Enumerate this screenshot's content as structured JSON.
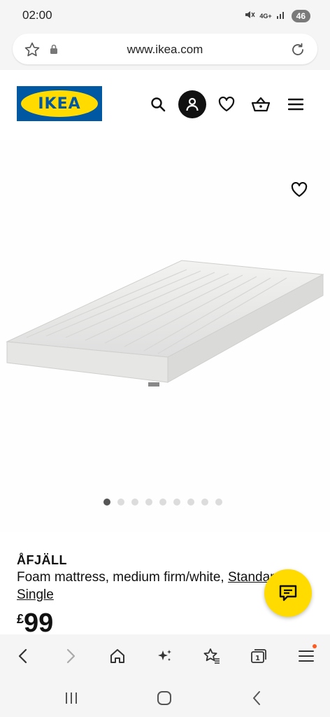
{
  "status_bar": {
    "time": "02:00",
    "network": "4G+",
    "battery": "46"
  },
  "browser": {
    "url": "www.ikea.com"
  },
  "header": {
    "logo_text": "IKEA"
  },
  "product": {
    "image_count": 9,
    "active_image_index": 0,
    "name": "ÅFJÄLL",
    "description_prefix": "Foam mattress, medium firm/white, ",
    "size_link": "Standard Single",
    "price_currency": "£",
    "price_value": "99"
  },
  "colors": {
    "ikea_blue": "#0058a3",
    "ikea_yellow": "#ffdb00",
    "notification_dot": "#ff5a1f"
  },
  "icons": {
    "status": [
      "mute-icon",
      "signal-icon",
      "battery-icon"
    ],
    "url_bar": [
      "star-icon",
      "lock-icon",
      "reload-icon"
    ],
    "header": [
      "search-icon",
      "account-icon",
      "heart-icon",
      "basket-icon",
      "menu-icon"
    ],
    "toolbar": [
      "back-icon",
      "forward-icon",
      "home-icon",
      "sparkle-icon",
      "bookmarks-icon",
      "tabs-icon",
      "browser-menu-icon"
    ],
    "system_nav": [
      "recents-icon",
      "home-nav-icon",
      "back-nav-icon"
    ]
  }
}
